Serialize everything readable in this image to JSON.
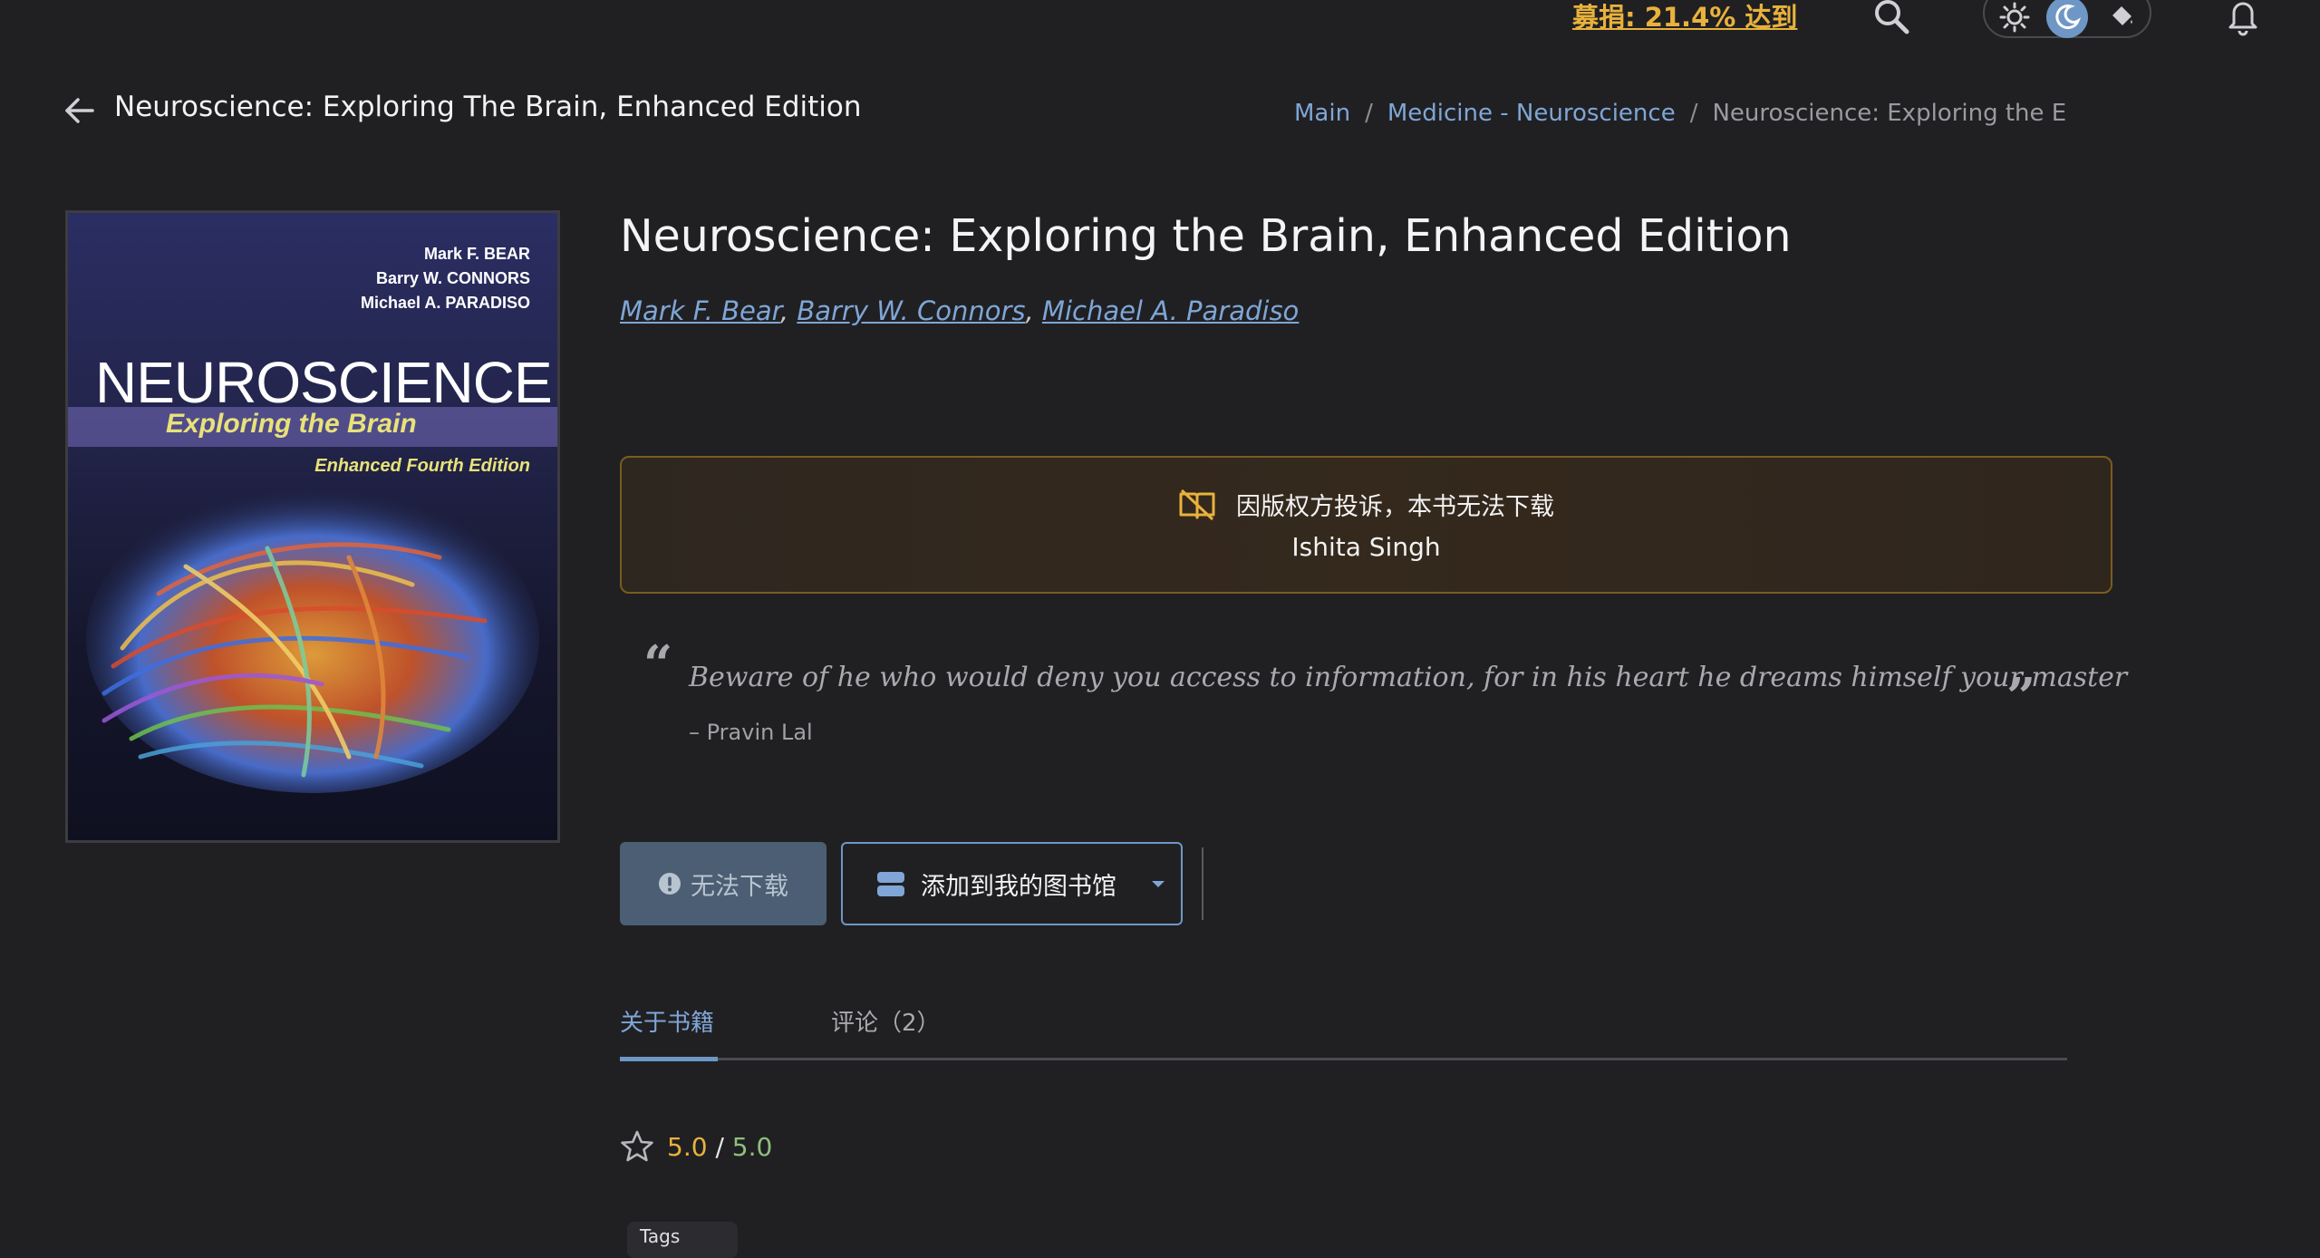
{
  "topbar": {
    "donate_label": "募捐: 21.4% 达到",
    "icons": [
      "search-icon",
      "sun-icon",
      "moon-icon",
      "paint-bucket-icon",
      "bell-icon"
    ]
  },
  "header": {
    "page_title": "Neuroscience: Exploring The Brain, Enhanced Edition",
    "breadcrumb": {
      "main": "Main",
      "sep": "/",
      "category": "Medicine - Neuroscience",
      "current": "Neuroscience: Exploring the E"
    }
  },
  "cover": {
    "authors": [
      "Mark F. BEAR",
      "Barry W. CONNORS",
      "Michael A. PARADISO"
    ],
    "title": "NEUROSCIENCE",
    "subtitle": "Exploring the Brain",
    "edition": "Enhanced Fourth Edition"
  },
  "book": {
    "title": "Neuroscience: Exploring the Brain, Enhanced Edition",
    "authors": [
      "Mark F. Bear",
      "Barry W. Connors",
      "Michael A. Paradiso"
    ],
    "author_sep": ","
  },
  "notice": {
    "line1": "因版权方投诉，本书无法下载",
    "line2": "Ishita Singh"
  },
  "quote": {
    "open": "“",
    "text": "Beware of he who would deny you access to information, for in his heart he dreams himself your master",
    "close": "”",
    "author": "– Pravin Lal"
  },
  "actions": {
    "no_download": "无法下载",
    "add_library": "添加到我的图书馆"
  },
  "tabs": {
    "about": "关于书籍",
    "comments": "评论（2）"
  },
  "rating": {
    "value": "5.0",
    "sep": "/",
    "max": "5.0"
  },
  "tag": {
    "label": "Tags"
  },
  "colors": {
    "background": "#202023",
    "accent": "#6f97c6",
    "link": "#7fa6d6",
    "donate": "#e8b23c",
    "notice_border": "#7a5c1e",
    "rating_max": "#8ec07c"
  }
}
